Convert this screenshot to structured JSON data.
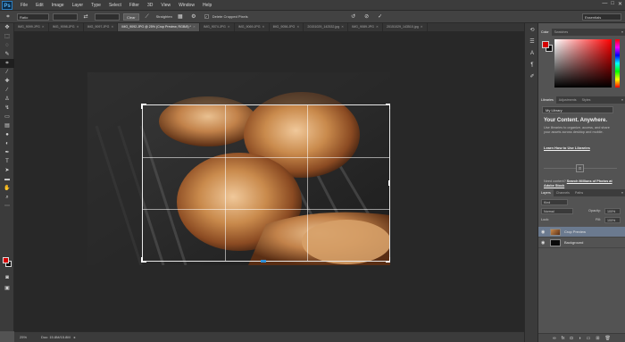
{
  "app": {
    "logo": "Ps"
  },
  "menu": [
    "File",
    "Edit",
    "Image",
    "Layer",
    "Type",
    "Select",
    "Filter",
    "3D",
    "View",
    "Window",
    "Help"
  ],
  "window_buttons": [
    "—",
    "□",
    "✕"
  ],
  "options": {
    "ratio_select": "Ratio",
    "clear_label": "Clear",
    "straighten_label": "Straighten",
    "delete_cropped_label": "Delete Cropped Pixels",
    "delete_cropped_checked": true,
    "workspace": "Essentials"
  },
  "tabs": [
    {
      "label": "IMG_9099.JPG",
      "active": false
    },
    {
      "label": "IMG_9098.JPG",
      "active": false
    },
    {
      "label": "IMG_9097.JPG",
      "active": false
    },
    {
      "label": "IMG_9092.JPG @ 25% (Crop Preview, RGB/8) *",
      "active": true
    },
    {
      "label": "IMG_9074.JPG",
      "active": false
    },
    {
      "label": "IMG_9069.JPG",
      "active": false
    },
    {
      "label": "IMG_9056.JPG",
      "active": false
    },
    {
      "label": "20151029_142532.jpg",
      "active": false
    },
    {
      "label": "IMG_9089.JPG",
      "active": false
    },
    {
      "label": "20151029_143510.jpg",
      "active": false
    }
  ],
  "status": {
    "zoom": "25%",
    "doc": "Doc: 15.8M/15.8M"
  },
  "color_panel": {
    "tabs": [
      "Color",
      "Swatches"
    ],
    "foreground": "#d40000",
    "background": "#111111"
  },
  "libraries_panel": {
    "tabs": [
      "Libraries",
      "Adjustments",
      "Styles"
    ],
    "library_select": "My Library",
    "title": "Your Content. Anywhere.",
    "body": "Use libraries to organize, access, and share your assets across desktop and mobile.",
    "learn_link": "Learn How to Use Libraries",
    "need_text": "Need content?",
    "need_link": "Search Millions of Photos at Adobe Stock"
  },
  "layers_panel": {
    "tabs": [
      "Layers",
      "Channels",
      "Paths"
    ],
    "kind_filter": "Kind",
    "blend_mode": "Normal",
    "opacity_label": "Opacity:",
    "opacity_value": "100%",
    "lock_label": "Lock:",
    "fill_label": "Fill:",
    "fill_value": "100%",
    "layers": [
      {
        "name": "Crop Preview",
        "selected": true
      },
      {
        "name": "Background",
        "selected": false
      }
    ]
  }
}
